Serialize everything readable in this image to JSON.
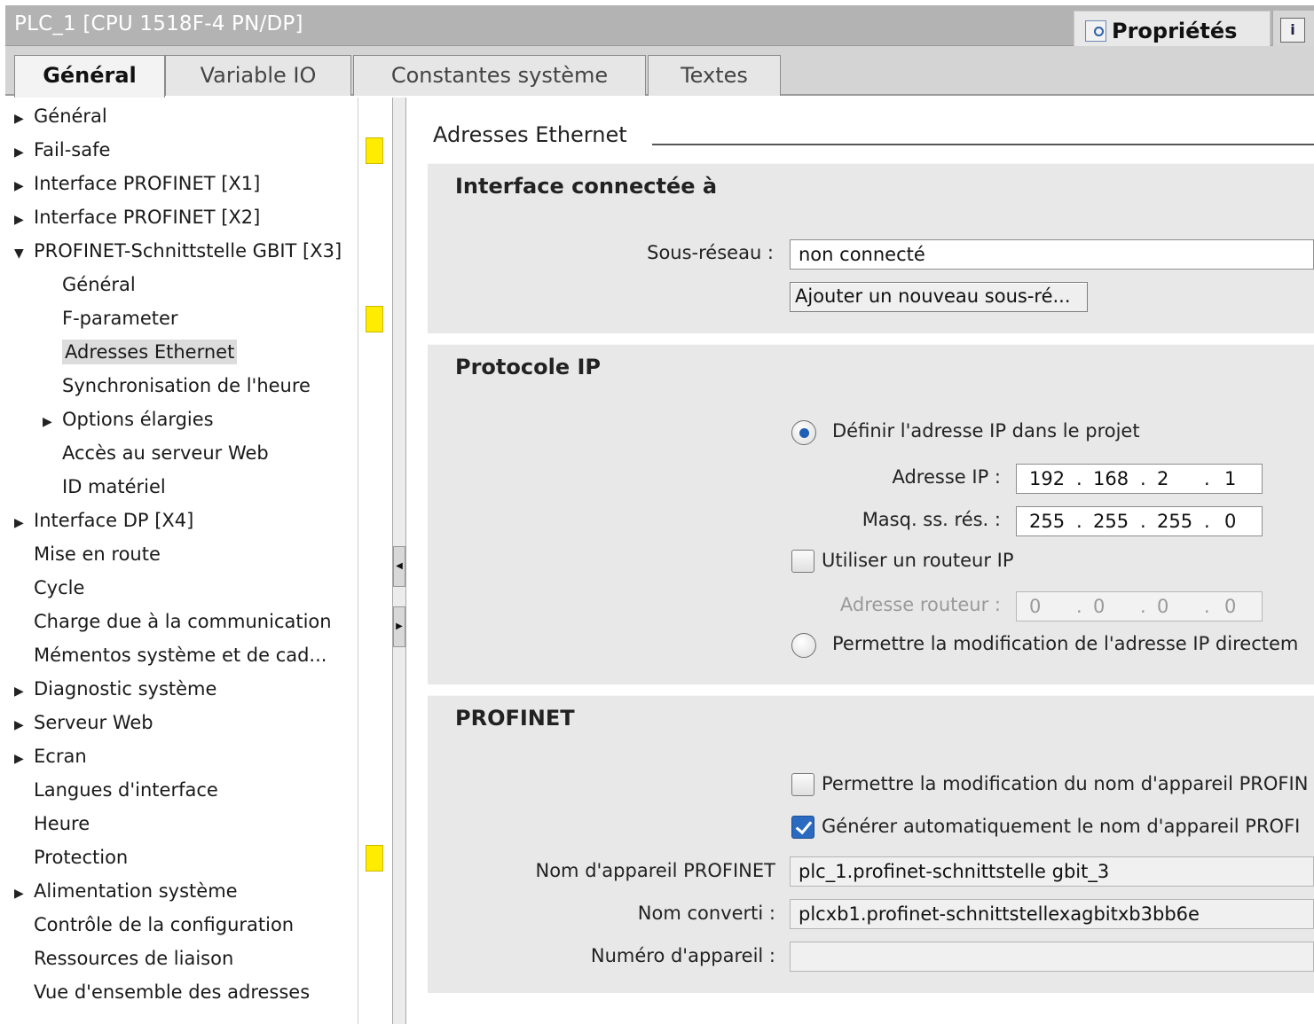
{
  "window": {
    "title": "PLC_1 [CPU 1518F-4 PN/DP]",
    "properties_tab": "Propriétés",
    "info_tab_icon": "info-icon"
  },
  "tabs": [
    "Général",
    "Variable IO",
    "Constantes système",
    "Textes"
  ],
  "active_tab": "Général",
  "tree": [
    {
      "label": "Général",
      "arrow": "▶"
    },
    {
      "label": "Fail-safe",
      "arrow": "▶",
      "flag": true
    },
    {
      "label": "Interface PROFINET [X1]",
      "arrow": "▶"
    },
    {
      "label": "Interface PROFINET [X2]",
      "arrow": "▶"
    },
    {
      "label": "PROFINET-Schnittstelle GBIT [X3]",
      "arrow": "▼"
    },
    {
      "label": "Général",
      "arrow": ""
    },
    {
      "label": "F-parameter",
      "arrow": "",
      "flag": true
    },
    {
      "label": "Adresses Ethernet",
      "arrow": "",
      "selected": true
    },
    {
      "label": "Synchronisation de l'heure",
      "arrow": ""
    },
    {
      "label": "Options élargies",
      "arrow": "▶"
    },
    {
      "label": "Accès au serveur Web",
      "arrow": ""
    },
    {
      "label": "ID matériel",
      "arrow": ""
    },
    {
      "label": "Interface DP [X4]",
      "arrow": "▶"
    },
    {
      "label": "Mise en route",
      "arrow": ""
    },
    {
      "label": "Cycle",
      "arrow": ""
    },
    {
      "label": "Charge due à la communication",
      "arrow": ""
    },
    {
      "label": "Mémentos système et de cad...",
      "arrow": ""
    },
    {
      "label": "Diagnostic système",
      "arrow": "▶"
    },
    {
      "label": "Serveur Web",
      "arrow": "▶"
    },
    {
      "label": "Ecran",
      "arrow": "▶"
    },
    {
      "label": "Langues d'interface",
      "arrow": ""
    },
    {
      "label": "Heure",
      "arrow": ""
    },
    {
      "label": "Protection",
      "arrow": "",
      "flag": true
    },
    {
      "label": "Alimentation système",
      "arrow": "▶"
    },
    {
      "label": "Contrôle de la configuration",
      "arrow": ""
    },
    {
      "label": "Ressources de liaison",
      "arrow": ""
    },
    {
      "label": "Vue d'ensemble des adresses",
      "arrow": ""
    }
  ],
  "section": {
    "title": "Adresses Ethernet"
  },
  "iface": {
    "heading": "Interface connectée à",
    "subnet_label": "Sous-réseau :",
    "subnet_value": "non connecté",
    "add_subnet_button": "Ajouter un nouveau sous-ré..."
  },
  "ip": {
    "heading": "Protocole IP",
    "opt_project": "Définir l'adresse IP dans le projet",
    "opt_project_selected": true,
    "addr_label": "Adresse IP :",
    "addr": [
      "192",
      "168",
      "2",
      "1"
    ],
    "mask_label": "Masq. ss. rés. :",
    "mask": [
      "255",
      "255",
      "255",
      "0"
    ],
    "router_check_label": "Utiliser un routeur IP",
    "router_checked": false,
    "router_label": "Adresse routeur :",
    "router": [
      "0",
      "0",
      "0",
      "0"
    ],
    "opt_direct": "Permettre la modification de l'adresse IP directem",
    "opt_direct_selected": false
  },
  "profinet": {
    "heading": "PROFINET",
    "allow_name_label": "Permettre la modification du nom d'appareil PROFIN",
    "allow_name_checked": false,
    "auto_name_label": "Générer automatiquement le nom d'appareil PROFI",
    "auto_name_checked": true,
    "name_label": "Nom d'appareil PROFINET",
    "name_value": "plc_1.profinet-schnittstelle gbit_3",
    "converted_label": "Nom converti :",
    "converted_value": "plcxb1.profinet-schnittstellexagbitxb3bb6e",
    "number_label": "Numéro d'appareil :",
    "number_value": ""
  },
  "colors": {
    "warning_flag": "#ffec00",
    "radio_accent": "#1f5fb4",
    "panel_bg": "#e8e8e8",
    "titlebar_bg": "#b3b3b3"
  }
}
